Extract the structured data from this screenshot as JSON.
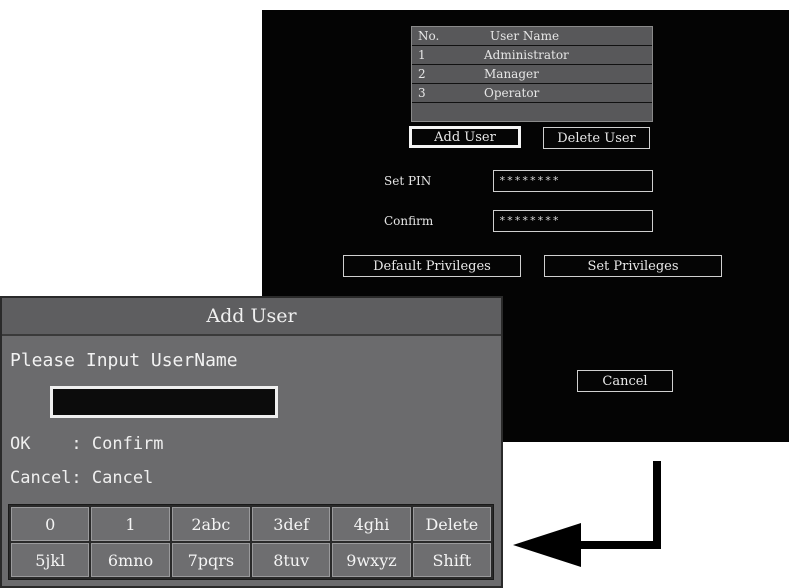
{
  "user_screen": {
    "table": {
      "headers": [
        "No.",
        "User Name"
      ],
      "rows": [
        {
          "no": "1",
          "name": "Administrator"
        },
        {
          "no": "2",
          "name": "Manager"
        },
        {
          "no": "3",
          "name": "Operator"
        },
        {
          "no": "",
          "name": ""
        }
      ]
    },
    "add_user_label": "Add User",
    "delete_user_label": "Delete User",
    "set_pin_label": "Set PIN",
    "set_pin_value": "********",
    "confirm_label": "Confirm",
    "confirm_value": "********",
    "default_privileges_label": "Default Privileges",
    "set_privileges_label": "Set Privileges",
    "cancel_label": "Cancel"
  },
  "dialog": {
    "title": "Add User",
    "prompt": "Please Input UserName",
    "input_value": "",
    "hint_ok": "OK    : Confirm",
    "hint_cancel": "Cancel: Cancel",
    "keys": [
      "0",
      "1",
      "2abc",
      "3def",
      "4ghi",
      "Delete",
      "5jkl",
      "6mno",
      "7pqrs",
      "8tuv",
      "9wxyz",
      "Shift"
    ]
  }
}
